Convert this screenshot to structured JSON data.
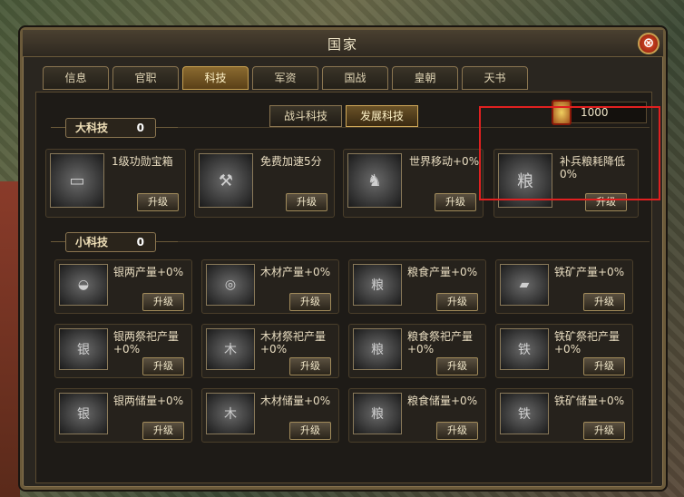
{
  "window": {
    "title": "国家",
    "close_label": "⊗"
  },
  "tabs": [
    {
      "label": "信息"
    },
    {
      "label": "官职"
    },
    {
      "label": "科技"
    },
    {
      "label": "军资"
    },
    {
      "label": "国战"
    },
    {
      "label": "皇朝"
    },
    {
      "label": "天书"
    }
  ],
  "subtabs": [
    {
      "label": "战斗科技"
    },
    {
      "label": "发展科技"
    }
  ],
  "currency": {
    "value": "1000"
  },
  "big_tech": {
    "label": "大科技",
    "count": "0",
    "items": [
      {
        "name": "1级功勋宝箱",
        "icon": "treasure-chest-icon",
        "glyph": "▭",
        "button": "升级"
      },
      {
        "name": "免费加速5分",
        "icon": "hammer-icon",
        "glyph": "⚒",
        "button": "升级"
      },
      {
        "name": "世界移动+0%",
        "icon": "army-march-icon",
        "glyph": "♞",
        "button": "升级"
      },
      {
        "name": "补兵粮耗降低0%",
        "icon": "grain-sack-icon",
        "glyph": "粮",
        "button": "升级"
      }
    ]
  },
  "small_tech": {
    "label": "小科技",
    "count": "0",
    "rows": [
      [
        {
          "name": "银两产量+0%",
          "icon": "silver-ingot-icon",
          "glyph": "◒",
          "button": "升级"
        },
        {
          "name": "木材产量+0%",
          "icon": "logs-icon",
          "glyph": "◎",
          "button": "升级"
        },
        {
          "name": "粮食产量+0%",
          "icon": "grain-bag-icon",
          "glyph": "粮",
          "button": "升级"
        },
        {
          "name": "铁矿产量+0%",
          "icon": "iron-bar-icon",
          "glyph": "▰",
          "button": "升级"
        }
      ],
      [
        {
          "name": "银两祭祀产量+0%",
          "icon": "silver-jar-icon",
          "glyph": "银",
          "button": "升级"
        },
        {
          "name": "木材祭祀产量+0%",
          "icon": "wood-jar-icon",
          "glyph": "木",
          "button": "升级"
        },
        {
          "name": "粮食祭祀产量+0%",
          "icon": "grain-jar-icon",
          "glyph": "粮",
          "button": "升级"
        },
        {
          "name": "铁矿祭祀产量+0%",
          "icon": "iron-jar-icon",
          "glyph": "铁",
          "button": "升级"
        }
      ],
      [
        {
          "name": "银两储量+0%",
          "icon": "silver-storage-icon",
          "glyph": "银",
          "button": "升级"
        },
        {
          "name": "木材储量+0%",
          "icon": "wood-storage-icon",
          "glyph": "木",
          "button": "升级"
        },
        {
          "name": "粮食储量+0%",
          "icon": "grain-storage-icon",
          "glyph": "粮",
          "button": "升级"
        },
        {
          "name": "铁矿储量+0%",
          "icon": "iron-storage-icon",
          "glyph": "铁",
          "button": "升级"
        }
      ]
    ]
  }
}
